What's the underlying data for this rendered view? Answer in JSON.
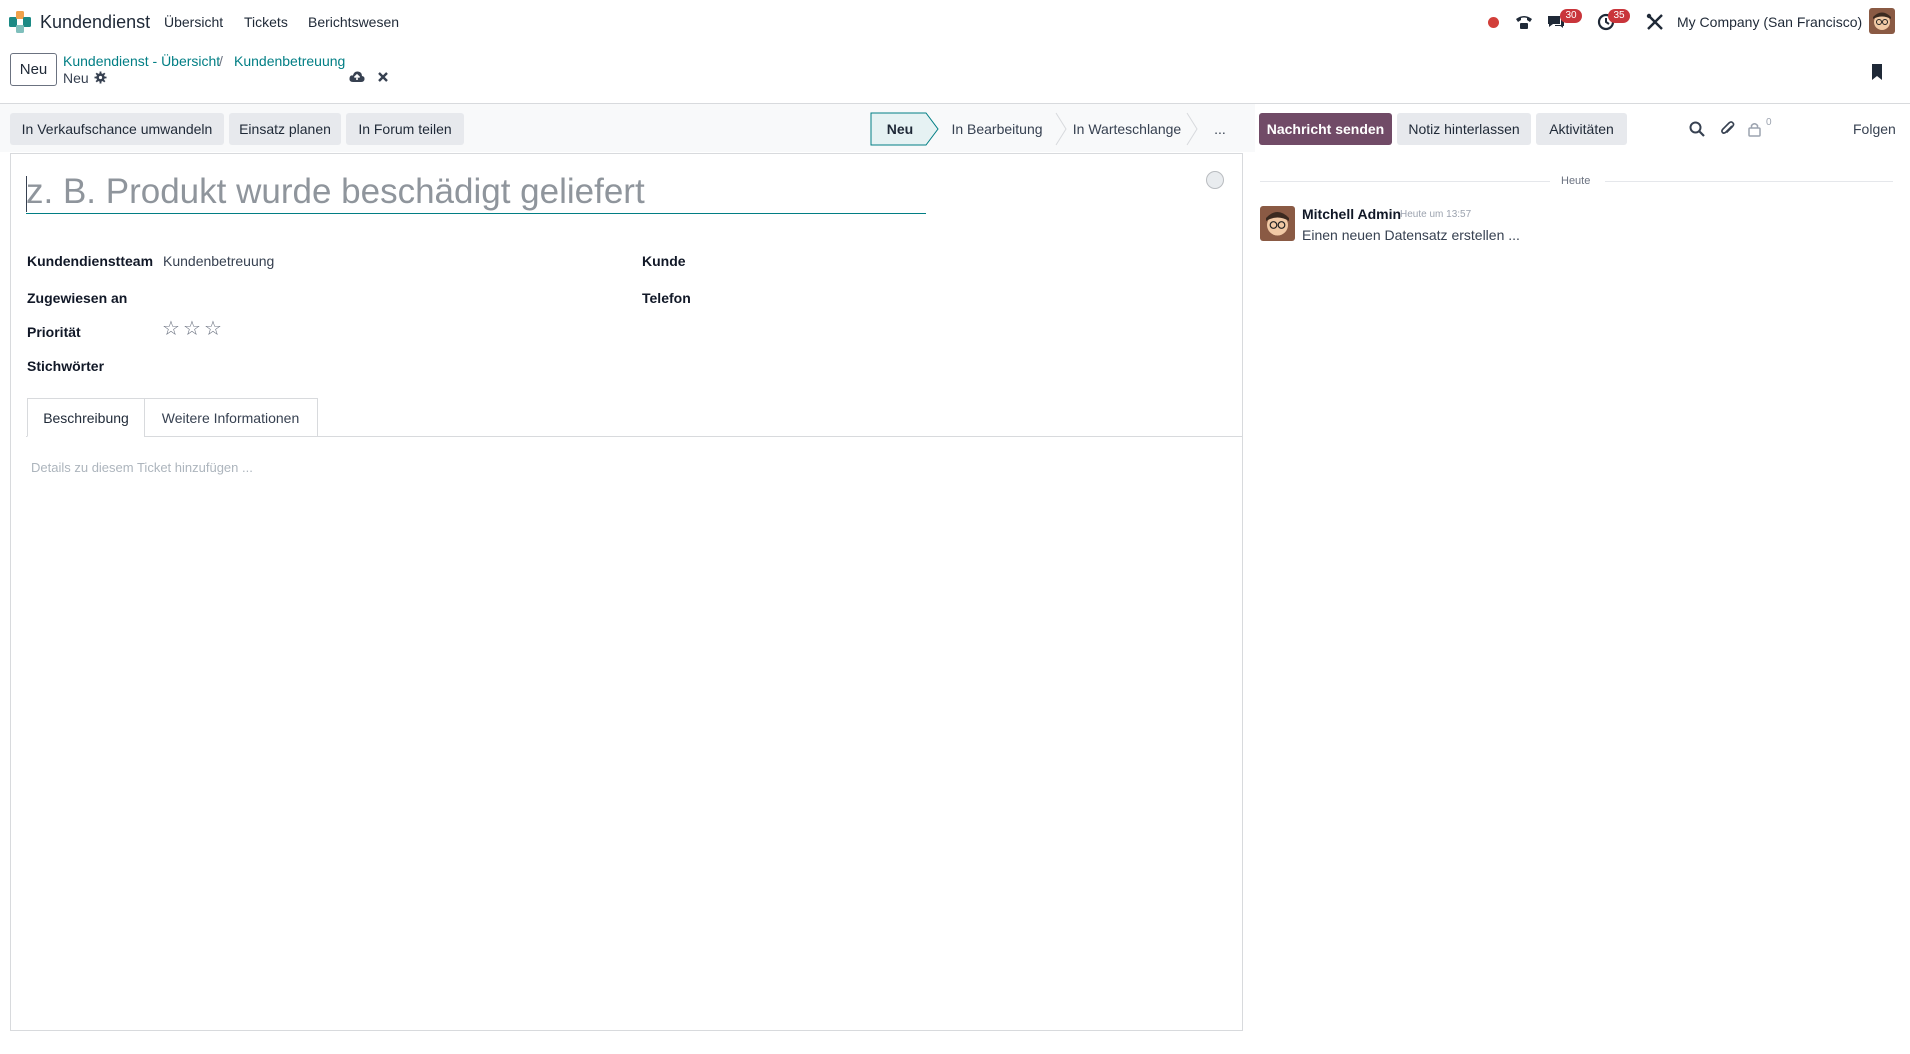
{
  "navbar": {
    "app_name": "Kundendienst",
    "menu": [
      "Übersicht",
      "Tickets",
      "Berichtswesen"
    ],
    "badges": {
      "messages": "30",
      "activities": "35"
    },
    "company": "My Company (San Francisco)"
  },
  "control": {
    "new_label": "Neu",
    "breadcrumbs": [
      "Kundendienst - Übersicht",
      "Kundenbetreuung"
    ],
    "separator": "/",
    "record_name": "Neu"
  },
  "actions": {
    "buttons": [
      "In Verkaufschance umwandeln",
      "Einsatz planen",
      "In Forum teilen"
    ],
    "stages": [
      "Neu",
      "In Bearbeitung",
      "In Warteschlange",
      "..."
    ],
    "active_stage": "Neu"
  },
  "form": {
    "title_placeholder": "z. B. Produkt wurde beschädigt geliefert",
    "fields": {
      "team_label": "Kundendienstteam",
      "team_value": "Kundenbetreuung",
      "assigned_label": "Zugewiesen an",
      "priority_label": "Priorität",
      "priority_stars": 0,
      "tags_label": "Stichwörter",
      "customer_label": "Kunde",
      "phone_label": "Telefon"
    },
    "tabs": [
      "Beschreibung",
      "Weitere Informationen"
    ],
    "description_placeholder": "Details zu diesem Ticket hinzufügen ..."
  },
  "chatter": {
    "send_message": "Nachricht senden",
    "log_note": "Notiz hinterlassen",
    "activities": "Aktivitäten",
    "followers_count": "0",
    "follow": "Folgen",
    "date_separator": "Heute",
    "messages": [
      {
        "author": "Mitchell Admin",
        "time": "Heute um 13:57",
        "body": "Einen neuen Datensatz erstellen ..."
      }
    ]
  },
  "colors": {
    "primary": "#714b67",
    "accent": "#017e84",
    "badge": "#c9353b",
    "status_dot": "#d23f3a"
  }
}
